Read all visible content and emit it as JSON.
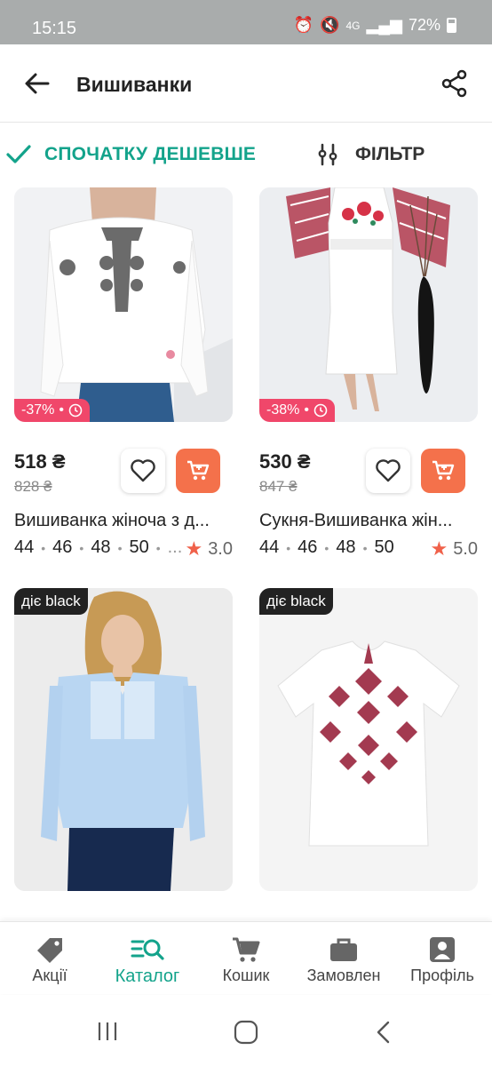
{
  "status": {
    "time": "15:15",
    "network": "4G",
    "battery": "72%"
  },
  "appbar": {
    "title": "Вишиванки"
  },
  "sort": {
    "label": "СПОЧАТКУ ДЕШЕВШЕ"
  },
  "filter": {
    "label": "ФІЛЬТР"
  },
  "products": [
    {
      "price": "518 ₴",
      "old_price": "828 ₴",
      "discount": "-37%",
      "name": "Вишиванка жіноча з д...",
      "sizes": [
        "44",
        "46",
        "48",
        "50",
        "..."
      ],
      "rating": "3.0"
    },
    {
      "price": "530 ₴",
      "old_price": "847 ₴",
      "discount": "-38%",
      "name": "Сукня-Вишиванка жін...",
      "sizes": [
        "44",
        "46",
        "48",
        "50"
      ],
      "rating": "5.0"
    },
    {
      "badge": "діє black"
    },
    {
      "badge": "діє black"
    }
  ],
  "nav": [
    {
      "label": "Акції",
      "icon": "tag-icon"
    },
    {
      "label": "Каталог",
      "icon": "catalog-search-icon",
      "active": true
    },
    {
      "label": "Кошик",
      "icon": "cart-icon"
    },
    {
      "label": "Замовлен",
      "icon": "briefcase-icon"
    },
    {
      "label": "Профіль",
      "icon": "profile-icon"
    }
  ],
  "colors": {
    "accent": "#13a38b",
    "cart": "#f4714b",
    "discount": "#f0476a",
    "star": "#f0614a"
  }
}
